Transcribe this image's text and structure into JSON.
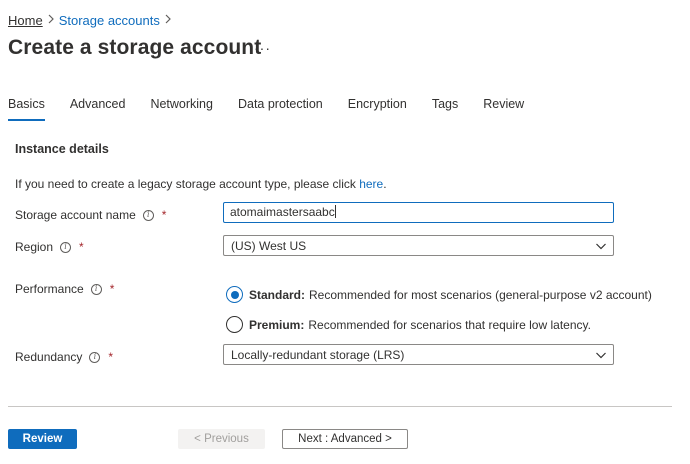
{
  "breadcrumb": {
    "home": "Home",
    "storage_accounts": "Storage accounts"
  },
  "page": {
    "title": "Create a storage account",
    "more": "···"
  },
  "tabs": [
    {
      "label": "Basics",
      "active": true
    },
    {
      "label": "Advanced",
      "active": false
    },
    {
      "label": "Networking",
      "active": false
    },
    {
      "label": "Data protection",
      "active": false
    },
    {
      "label": "Encryption",
      "active": false
    },
    {
      "label": "Tags",
      "active": false
    },
    {
      "label": "Review",
      "active": false
    }
  ],
  "instance_details": {
    "heading": "Instance details",
    "legacy_text": "If you need to create a legacy storage account type, please click ",
    "legacy_link": "here",
    "legacy_period": "."
  },
  "fields": {
    "storage_account_name": {
      "label": "Storage account name",
      "value": "atomaimastersaabc",
      "required": "*"
    },
    "region": {
      "label": "Region",
      "value": "(US) West US",
      "required": "*"
    },
    "performance": {
      "label": "Performance",
      "required": "*",
      "options": [
        {
          "name": "Standard:",
          "description": "Recommended for most scenarios (general-purpose v2 account)",
          "selected": true
        },
        {
          "name": "Premium:",
          "description": "Recommended for scenarios that require low latency.",
          "selected": false
        }
      ]
    },
    "redundancy": {
      "label": "Redundancy",
      "value": "Locally-redundant storage (LRS)",
      "required": "*"
    }
  },
  "footer": {
    "review": "Review",
    "previous": "< Previous",
    "next": "Next : Advanced >"
  },
  "colors": {
    "accent": "#0f6cbd",
    "required": "#a4262c",
    "text": "#323130"
  }
}
